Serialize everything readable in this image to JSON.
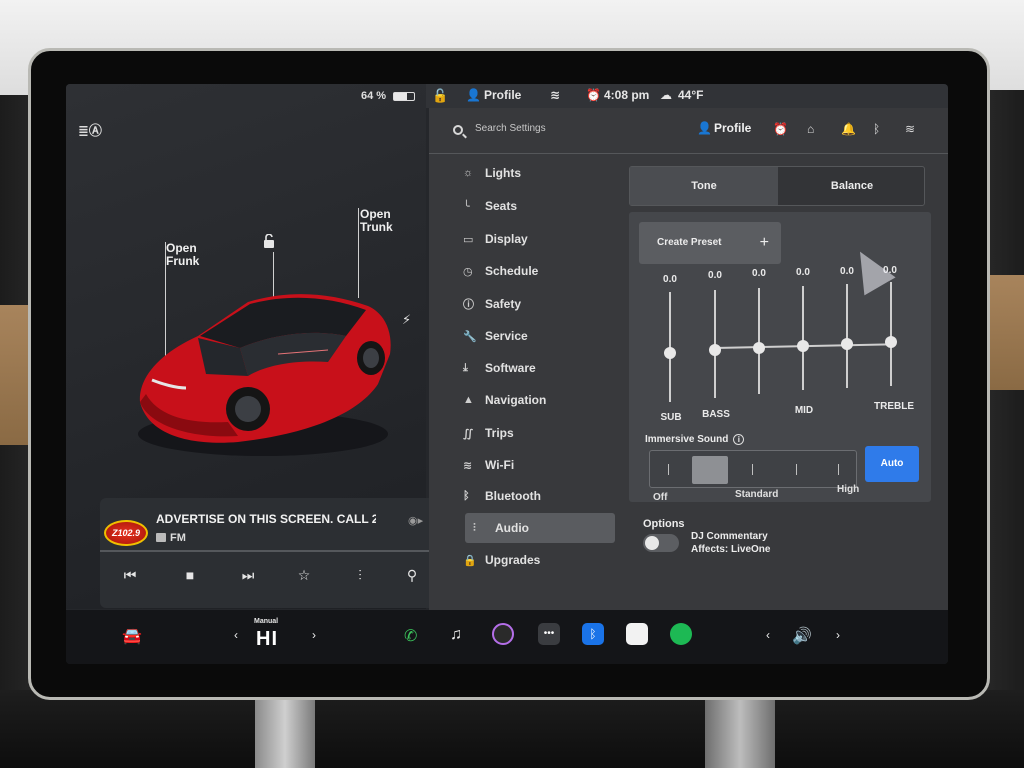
{
  "status": {
    "battery": "64 %",
    "time": "4:08 pm",
    "temperature": "44°F",
    "profile": "Profile"
  },
  "car": {
    "frunk_label": "Open\nFrunk",
    "trunk_label": "Open\nTrunk"
  },
  "media": {
    "station_logo_text": "Z102.9",
    "title": "ADVERTISE ON THIS SCREEN. CALL 2",
    "source": "FM",
    "progress": 0
  },
  "settings": {
    "search_placeholder": "Search Settings",
    "header_profile": "Profile",
    "menu": [
      {
        "label": "Lights",
        "icon": "sun-icon"
      },
      {
        "label": "Seats",
        "icon": "seat-icon"
      },
      {
        "label": "Display",
        "icon": "display-icon"
      },
      {
        "label": "Schedule",
        "icon": "clock-icon"
      },
      {
        "label": "Safety",
        "icon": "info-icon"
      },
      {
        "label": "Service",
        "icon": "wrench-icon"
      },
      {
        "label": "Software",
        "icon": "download-icon"
      },
      {
        "label": "Navigation",
        "icon": "navigation-icon"
      },
      {
        "label": "Trips",
        "icon": "trips-icon"
      },
      {
        "label": "Wi-Fi",
        "icon": "wifi-icon"
      },
      {
        "label": "Bluetooth",
        "icon": "bluetooth-icon"
      },
      {
        "label": "Audio",
        "icon": "equalizer-icon",
        "active": true
      },
      {
        "label": "Upgrades",
        "icon": "bag-icon"
      }
    ],
    "audio": {
      "tabs": [
        "Tone",
        "Balance"
      ],
      "active_tab": "Tone",
      "create_preset": "Create Preset",
      "equalizer": [
        {
          "label": "SUB",
          "value": "0.0"
        },
        {
          "label": "BASS",
          "value": "0.0"
        },
        {
          "label": "",
          "value": "0.0"
        },
        {
          "label": "MID",
          "value": "0.0"
        },
        {
          "label": "",
          "value": "0.0"
        },
        {
          "label": "TREBLE",
          "value": "0.0"
        }
      ],
      "immersive_title": "Immersive Sound",
      "immersive_labels": [
        "Off",
        "Standard",
        "High"
      ],
      "immersive_level": 0.2,
      "auto_label": "Auto",
      "options_title": "Options",
      "dj_commentary": "DJ Commentary",
      "dj_affects": "Affects: LiveOne"
    }
  },
  "dock": {
    "temp_mode": "Manual",
    "temp_value": "HI",
    "volume_icon": "speaker-icon"
  },
  "colors": {
    "accent_blue": "#2f7bea",
    "car_red": "#d0121b",
    "phone_green": "#3cc45c",
    "spotify_green": "#1db954"
  }
}
